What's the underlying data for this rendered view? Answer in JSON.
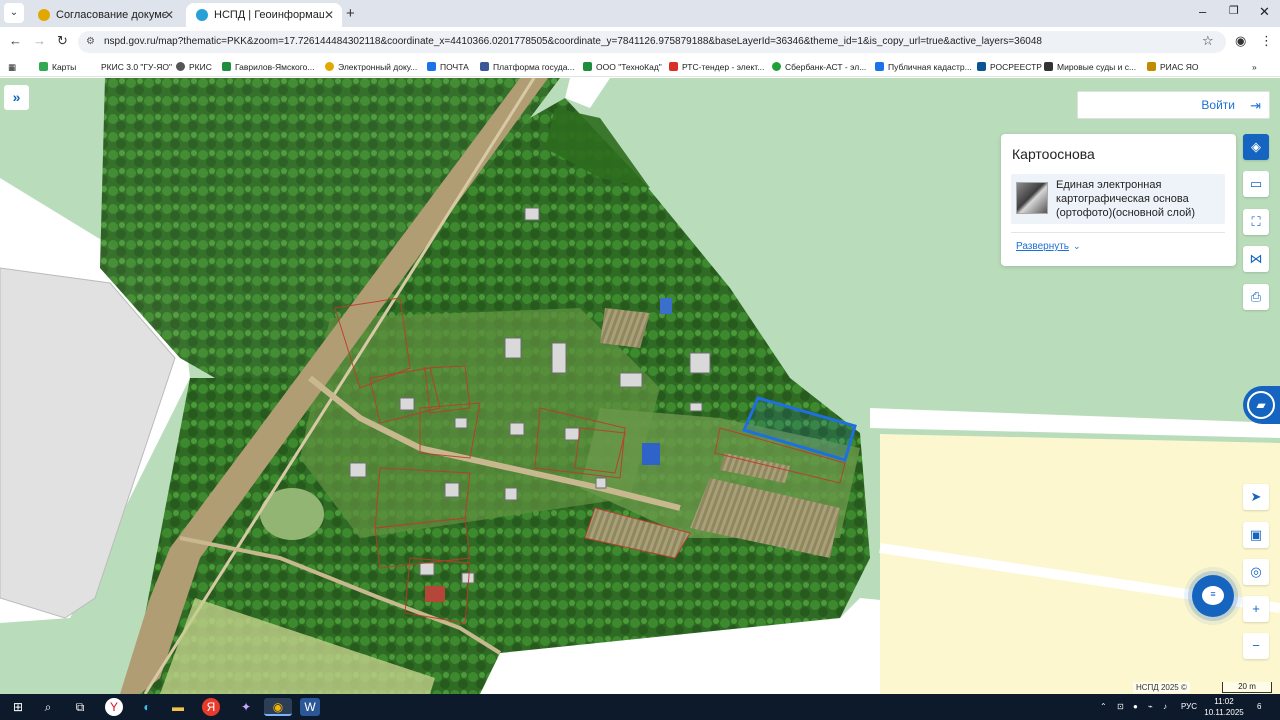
{
  "browser": {
    "tabs": [
      {
        "label": "Согласование документов : Н",
        "active": false
      },
      {
        "label": "НСПД | Геоинформационный",
        "active": true
      }
    ],
    "new_tab": "+",
    "url": "nspd.gov.ru/map?thematic=PKK&zoom=17.726144484302118&coordinate_x=4410366.0201778505&coordinate_y=7841126.975879188&baseLayerId=36346&theme_id=1&is_copy_url=true&active_layers=36048",
    "bookmarks": [
      {
        "label": "Карты",
        "color": "#34a853"
      },
      {
        "label": "РКИС 3.0 \"ГУ-ЯО\"",
        "color": "#ffffff"
      },
      {
        "label": "РКИС",
        "color": "#555555"
      },
      {
        "label": "Гаврилов-Ямского...",
        "color": "#1e8e3e"
      },
      {
        "label": "Электронный доку...",
        "color": "#d93025"
      },
      {
        "label": "ПОЧТА",
        "color": "#1a73e8"
      },
      {
        "label": "Платформа госуда...",
        "color": "#3b5998"
      },
      {
        "label": "ООО \"ТехноКад\"",
        "color": "#1e8e3e"
      },
      {
        "label": "РТС-тендер - элект...",
        "color": "#d93025"
      },
      {
        "label": "Сбербанк-АСТ - эл...",
        "color": "#21a038"
      },
      {
        "label": "Публичная кадастр...",
        "color": "#1a73e8"
      },
      {
        "label": "РОСРЕЕСТР",
        "color": "#0b5394"
      },
      {
        "label": "Мировые суды и с...",
        "color": "#333333"
      },
      {
        "label": "РИАС ЯО",
        "color": "#c28a00"
      }
    ]
  },
  "map": {
    "login_label": "Войти",
    "panel": {
      "title": "Картооснова",
      "layer_name": "Единая электронная картографическая основа (ортофото)(основной слой)",
      "expand_label": "Развернуть"
    },
    "tools": [
      "layers-icon",
      "ruler-icon",
      "select-area-icon",
      "share-icon",
      "print-icon"
    ],
    "zoom_in": "+",
    "zoom_out": "−",
    "copyright": "НСПД 2025 ©",
    "scale": "20 m",
    "colors": {
      "accent": "#1565c0",
      "forest_zone": "#b9dcbb",
      "agri_zone": "#fdf7cf",
      "selected_parcel": "#1e6fe0",
      "parcel_outline": "#c0392b"
    }
  },
  "taskbar": {
    "lang": "РУС",
    "time": "11:02",
    "date": "10.11.2025",
    "notifications": "6"
  }
}
